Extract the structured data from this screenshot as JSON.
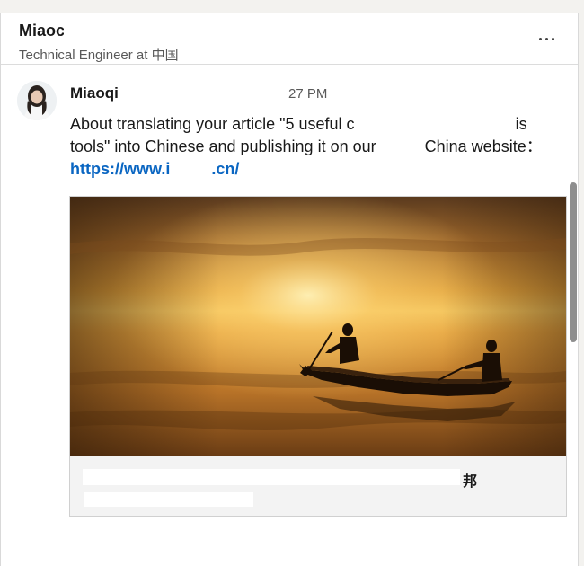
{
  "conversation": {
    "contact_name": "Miaoc",
    "contact_headline": "Technical Engineer at 中国",
    "more_label": "More options",
    "more_icon": "ellipsis-icon"
  },
  "message": {
    "sender": "Miaoqi",
    "time": "27 PM",
    "line1_start": "About translating your article \"5 useful c",
    "line1_end": "is",
    "line2_start": "tools\" into Chinese and publishing it on our",
    "line2_end": "China website：",
    "link": "https://www.i",
    "link_end": ".cn/"
  },
  "preview": {
    "title_tail": "邦"
  },
  "colors": {
    "link": "#0a66c2",
    "panel": "#ffffff",
    "page_bg": "#f3f2ef"
  }
}
